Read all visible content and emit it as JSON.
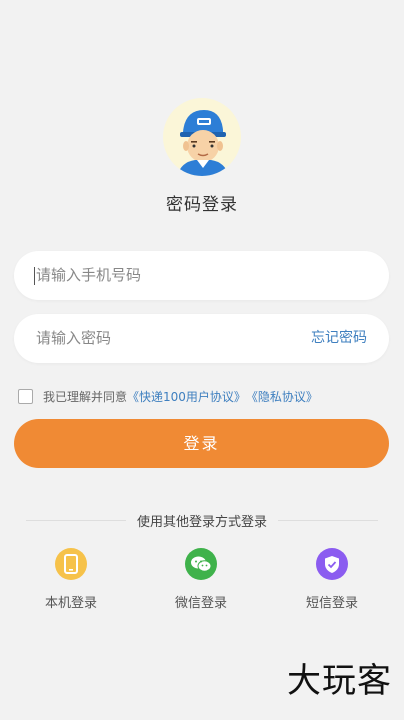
{
  "header": {
    "title": "密码登录"
  },
  "form": {
    "phone_placeholder": "请输入手机号码",
    "password_placeholder": "请输入密码",
    "forgot_password": "忘记密码"
  },
  "agreement": {
    "prefix": "我已理解并同意",
    "user_agreement": "《快递100用户协议》",
    "privacy_policy": "《隐私协议》",
    "checked": false
  },
  "login_button": "登录",
  "other_methods": {
    "title": "使用其他登录方式登录",
    "items": [
      {
        "label": "本机登录",
        "icon": "phone-icon",
        "color": "#f6c24a"
      },
      {
        "label": "微信登录",
        "icon": "wechat-icon",
        "color": "#3fb24b"
      },
      {
        "label": "短信登录",
        "icon": "shield-check-icon",
        "color": "#8b5cf0"
      }
    ]
  },
  "watermark": "大玩客",
  "colors": {
    "accent": "#f08a34",
    "link": "#3e7fbf",
    "background": "#f2f2f2"
  }
}
